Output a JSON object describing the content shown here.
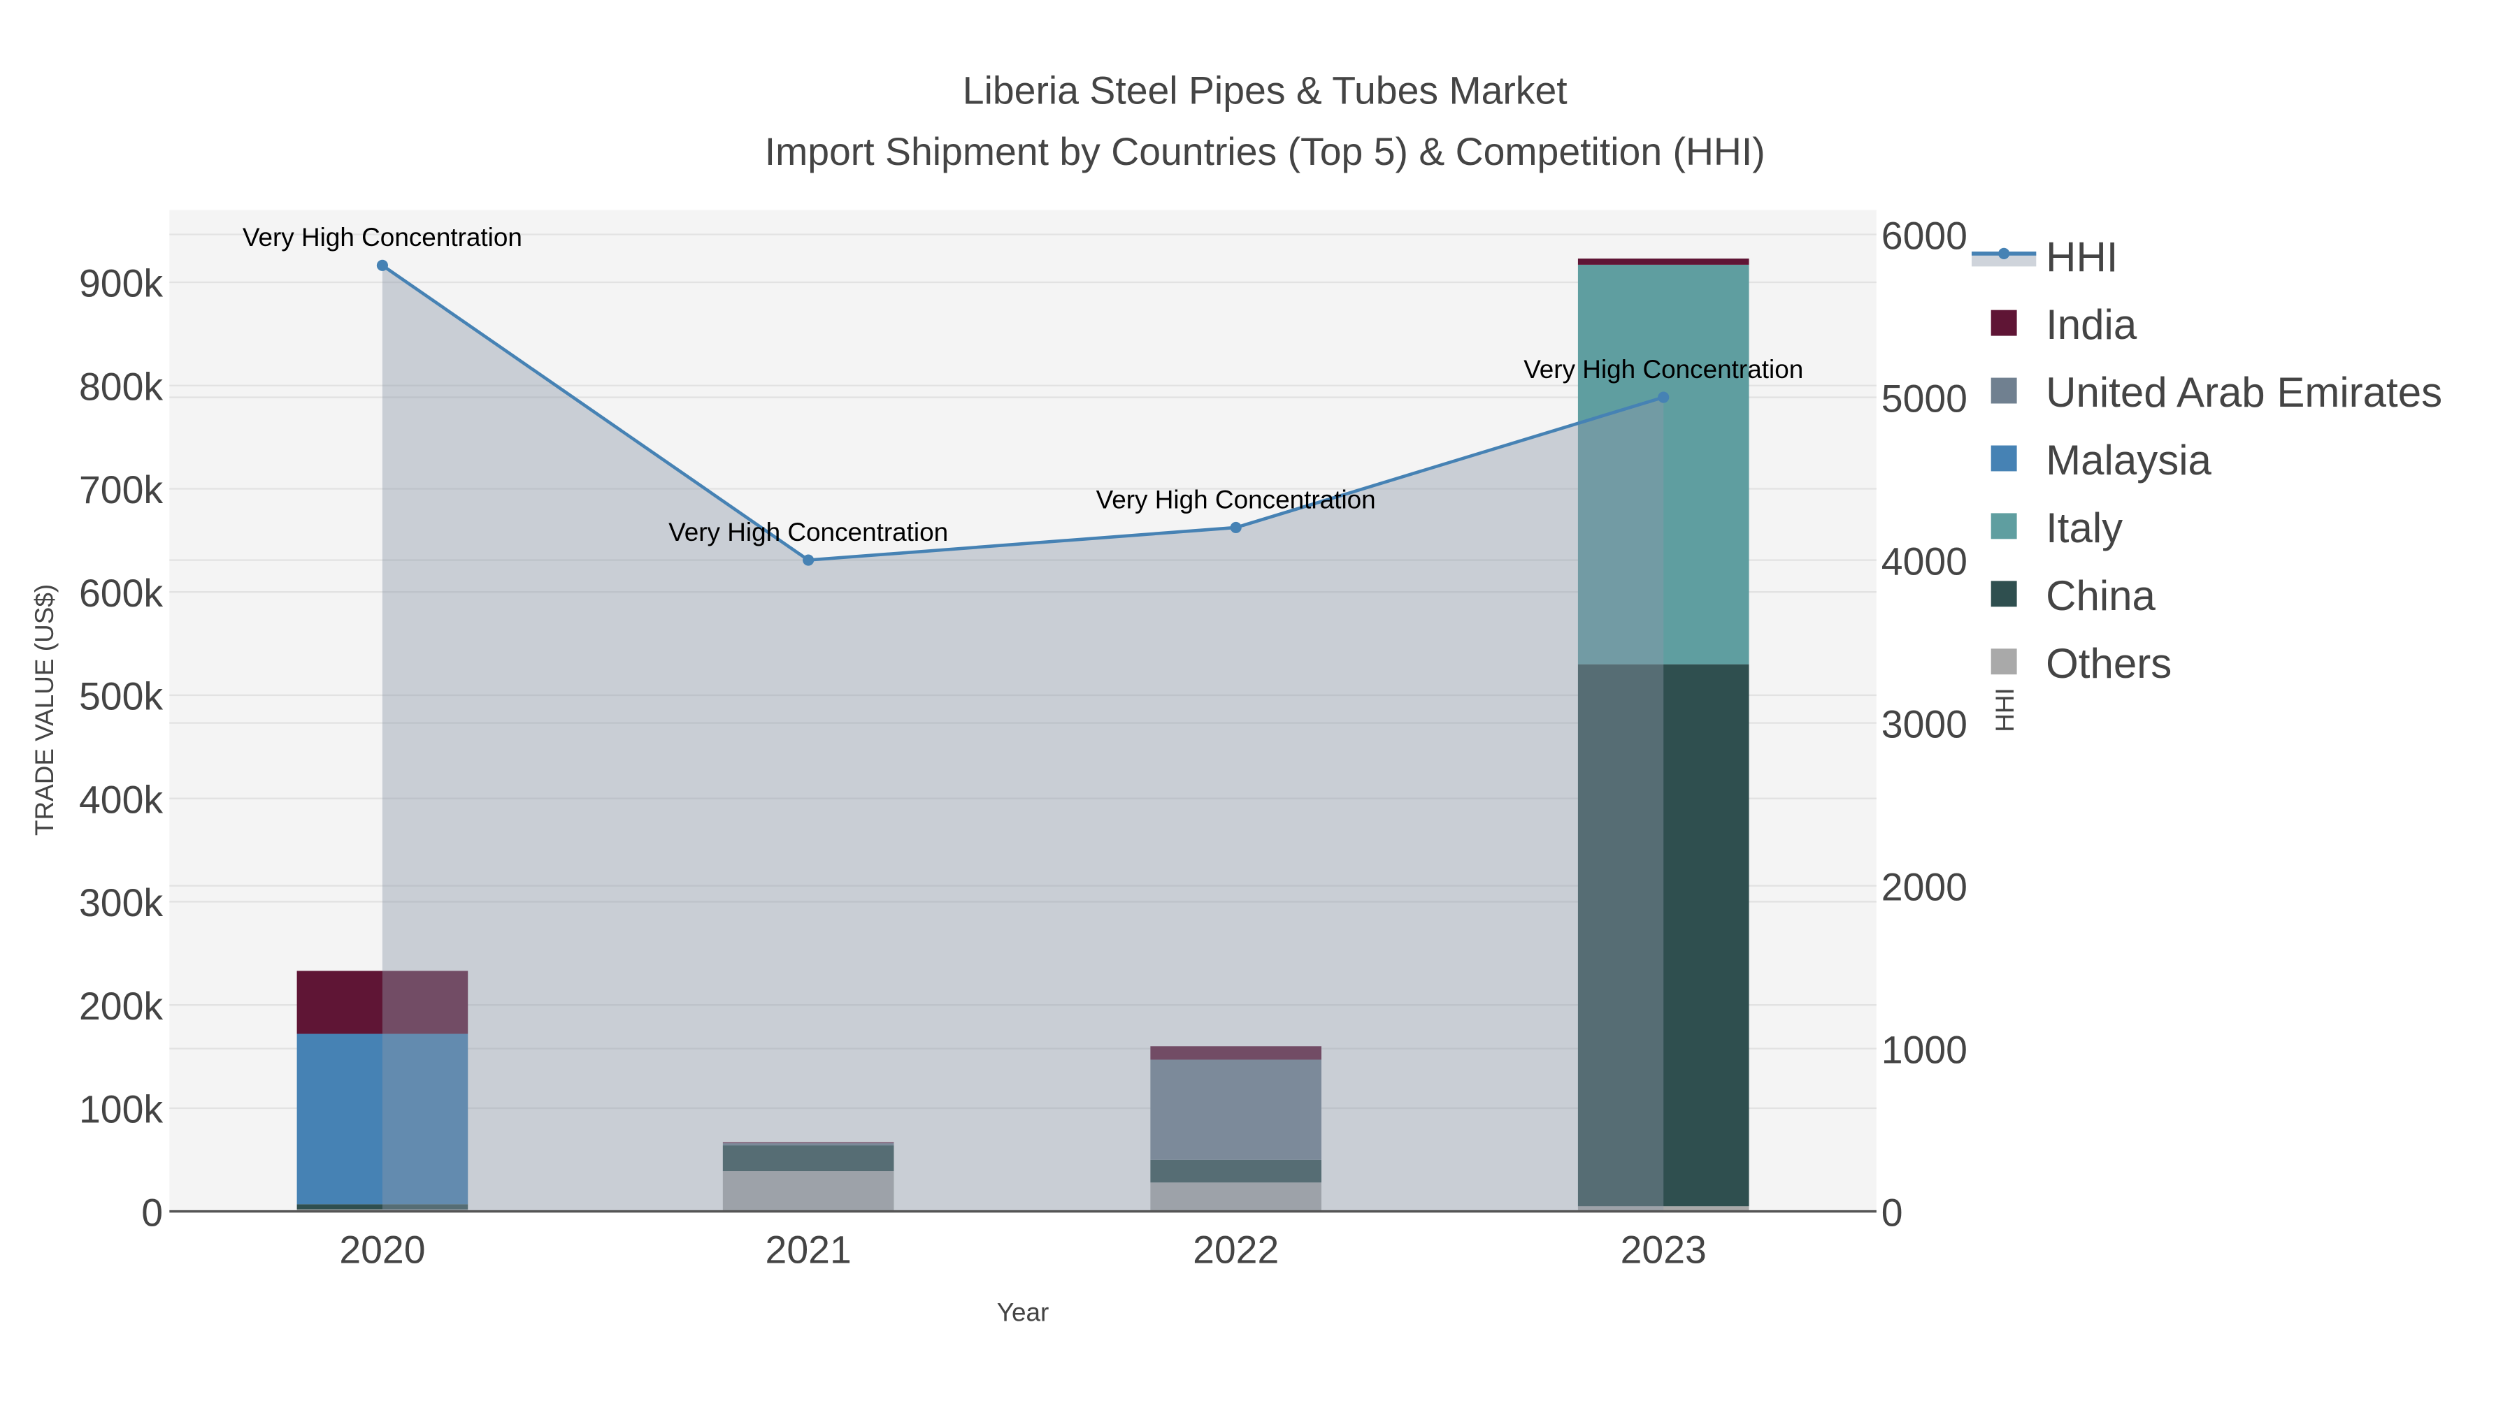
{
  "chart_data": {
    "type": "bar",
    "title": "Liberia Steel Pipes & Tubes Market",
    "subtitle": "Import Shipment by Countries (Top 5) & Competition (HHI)",
    "xlabel": "Year",
    "ylabel": "TRADE VALUE (US$)",
    "y2label": "HHI",
    "categories": [
      "2020",
      "2021",
      "2022",
      "2023"
    ],
    "ylim": [
      0,
      970000
    ],
    "y2lim": [
      0,
      6150
    ],
    "yticks": [
      0,
      100000,
      200000,
      300000,
      400000,
      500000,
      600000,
      700000,
      800000,
      900000
    ],
    "ytick_labels": [
      "0",
      "100k",
      "200k",
      "300k",
      "400k",
      "500k",
      "600k",
      "700k",
      "800k",
      "900k"
    ],
    "y2ticks": [
      0,
      1000,
      2000,
      3000,
      4000,
      5000,
      6000
    ],
    "y2tick_labels": [
      "0",
      "1000",
      "2000",
      "3000",
      "4000",
      "5000",
      "6000"
    ],
    "stacked": true,
    "series": [
      {
        "name": "Others",
        "color": "#a9a9a9",
        "values": [
          2000,
          39000,
          28000,
          5000
        ]
      },
      {
        "name": "China",
        "color": "#2f4f4f",
        "values": [
          5000,
          25000,
          22000,
          525000
        ]
      },
      {
        "name": "Italy",
        "color": "#5f9ea0",
        "values": [
          0,
          0,
          0,
          387000
        ]
      },
      {
        "name": "Malaysia",
        "color": "#4682b4",
        "values": [
          165000,
          0,
          0,
          0
        ]
      },
      {
        "name": "United Arab Emirates",
        "color": "#708090",
        "values": [
          0,
          2000,
          97000,
          0
        ]
      },
      {
        "name": "India",
        "color": "#5f1535",
        "values": [
          61000,
          1000,
          13000,
          6000
        ]
      }
    ],
    "line": {
      "name": "HHI",
      "color": "#4682b4",
      "axis": "right",
      "values": [
        5810,
        4000,
        4200,
        5000
      ],
      "fill": "tozeroy"
    },
    "annotations": [
      "Very High Concentration",
      "Very High Concentration",
      "Very High Concentration",
      "Very High Concentration"
    ],
    "legend_order": [
      "HHI",
      "India",
      "United Arab Emirates",
      "Malaysia",
      "Italy",
      "China",
      "Others"
    ],
    "legend_position": "right",
    "grid": true
  }
}
